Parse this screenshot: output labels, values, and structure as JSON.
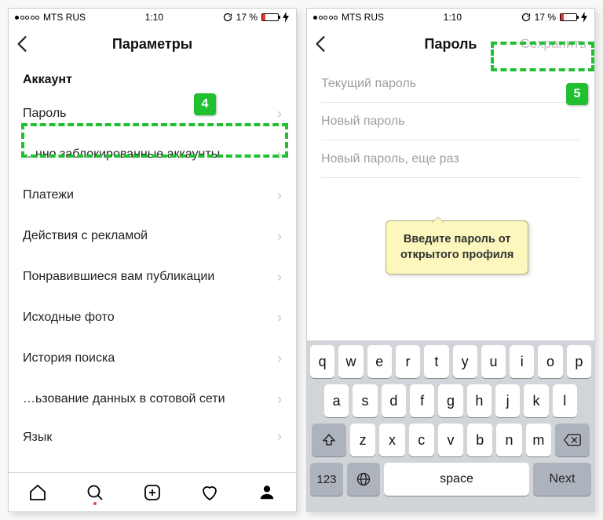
{
  "status": {
    "carrier": "MTS RUS",
    "time": "1:10",
    "battery_pct": "17 %"
  },
  "left": {
    "title": "Параметры",
    "section": "Аккаунт",
    "rows": [
      "Пароль",
      "…нно заблокированные аккаунты",
      "Платежи",
      "Действия с рекламой",
      "Понравившиеся вам публикации",
      "Исходные фото",
      "История поиска",
      "…ьзование данных в сотовой сети",
      "Язык"
    ]
  },
  "right": {
    "title": "Пароль",
    "action": "Сохранить",
    "fields": {
      "current": "Текущий пароль",
      "new": "Новый пароль",
      "repeat": "Новый пароль, еще раз"
    }
  },
  "steps": {
    "s4": "4",
    "s5": "5"
  },
  "callout": {
    "l1": "Введите пароль от",
    "l2": "открытого профиля"
  },
  "keyboard": {
    "r1": [
      "q",
      "w",
      "e",
      "r",
      "t",
      "y",
      "u",
      "i",
      "o",
      "p"
    ],
    "r2": [
      "a",
      "s",
      "d",
      "f",
      "g",
      "h",
      "j",
      "k",
      "l"
    ],
    "r3": [
      "z",
      "x",
      "c",
      "v",
      "b",
      "n",
      "m"
    ],
    "num": "123",
    "space": "space",
    "next": "Next"
  }
}
